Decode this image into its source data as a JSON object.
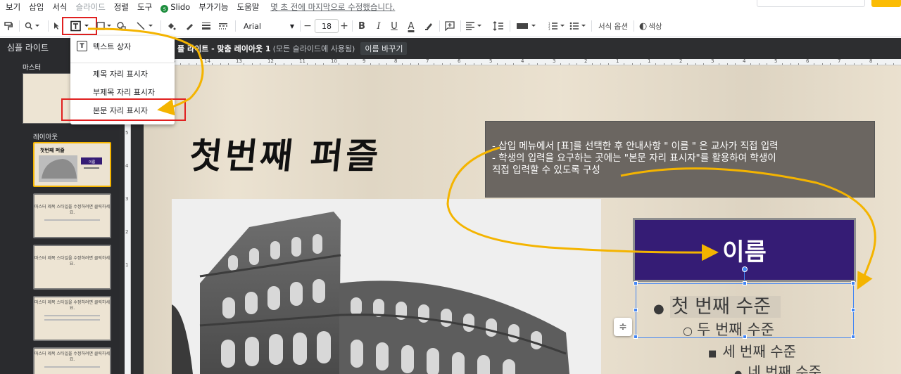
{
  "menu": {
    "items": [
      "보기",
      "삽입",
      "서식",
      "슬라이드",
      "정렬",
      "도구",
      "Slido",
      "부가기능",
      "도움말"
    ],
    "disabled_item": "슬라이드",
    "last_edit": "몇 초 전에 마지막으로 수정했습니다."
  },
  "toolbar": {
    "font": "Arial",
    "font_size": "18",
    "bold": "B",
    "italic": "I",
    "underline": "U",
    "text_color": "A",
    "format_options": "서식 옵션",
    "color_label": "색상"
  },
  "insert_menu": {
    "items": [
      "텍스트 상자",
      "제목 자리 표시자",
      "부제목 자리 표시자",
      "본문 자리 표시자"
    ],
    "text_box_icon": "text-box-icon"
  },
  "left_panel": {
    "title": "심플 라이트",
    "master_label": "마스터",
    "layouts_label": "레이아웃",
    "thumbs": [
      {
        "text": ""
      },
      {
        "text": "마스터 제목 스타일을 수정하려면 클릭하세요."
      },
      {
        "text": "마스터 제목 스타일을 수정하려면 클릭하세요."
      },
      {
        "text": "마스터 제목 스타일을 수정하려면 클릭하세요."
      },
      {
        "text": "마스터 제목 스타일을 수정하려면 클릭하세요."
      }
    ]
  },
  "layout_header": {
    "name": "플 라이트 - 맞춤 레이아웃 1",
    "note": "(모든 슬라이드에 사용됨)",
    "rename": "이름 바꾸기"
  },
  "ruler": {
    "h_numbers": [
      "5",
      "14",
      "13",
      "12",
      "11",
      "10",
      "9",
      "8",
      "7",
      "6",
      "5",
      "4",
      "3",
      "2",
      "1",
      "1",
      "2",
      "3",
      "4",
      "5",
      "6",
      "7",
      "8"
    ],
    "v_numbers": [
      "5",
      "4",
      "3",
      "2",
      "1"
    ]
  },
  "slide": {
    "title": "첫번째 퍼즐",
    "callout_lines": [
      "- 삽입 메뉴에서 [표]를 선택한 후 안내사항  \" 이름 \" 은 교사가 직접 입력",
      "- 학생의 입력을 요구하는 곳에는 \"본문 자리 표시자\"를 활용하여 학생이",
      "직접 입력할 수 있도록 구성"
    ],
    "name_box": "이름",
    "levels": [
      "첫 번째 수준",
      "두 번째 수준",
      "세 번째 수준",
      "네 번째 수준"
    ],
    "bullets": [
      "●",
      "○",
      "■",
      "●"
    ]
  },
  "colors": {
    "accent_yellow": "#f4b400",
    "highlight_red": "#e02020",
    "name_box_fill": "#351c75",
    "selection_blue": "#4285f4"
  }
}
